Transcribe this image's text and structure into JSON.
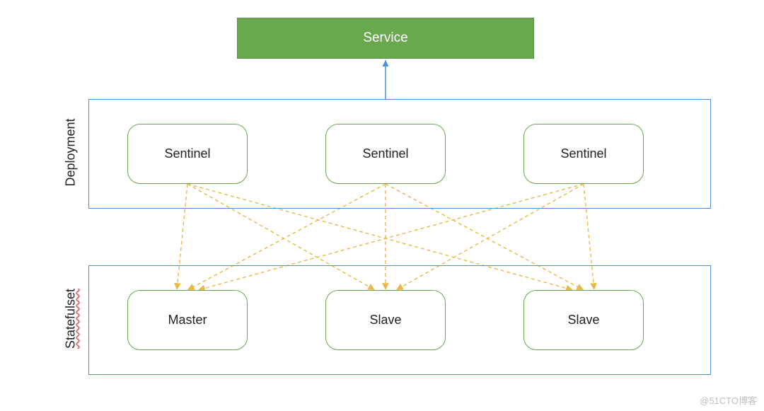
{
  "service": {
    "label": "Service"
  },
  "groups": {
    "deployment": {
      "label": "Deployment"
    },
    "statefulset": {
      "label": "Statefulset"
    }
  },
  "sentinels": [
    {
      "label": "Sentinel"
    },
    {
      "label": "Sentinel"
    },
    {
      "label": "Sentinel"
    }
  ],
  "nodes": [
    {
      "label": "Master"
    },
    {
      "label": "Slave"
    },
    {
      "label": "Slave"
    }
  ],
  "attribution": "@51CTO博客",
  "colors": {
    "service_bg": "#6aa84f",
    "group_border": "#4a90d9",
    "node_border": "#6aa84f",
    "arrow_yellow": "#e8b94a",
    "arrow_blue": "#4a90d9"
  },
  "chart_data": {
    "type": "diagram",
    "title": "",
    "description": "Architecture diagram showing a Service fronting a Deployment of 3 Sentinel instances, each connected to a StatefulSet of 1 Master and 2 Slave nodes.",
    "layers": [
      {
        "name": "Service",
        "kind": "service",
        "nodes": [
          "Service"
        ]
      },
      {
        "name": "Deployment",
        "kind": "deployment",
        "nodes": [
          "Sentinel",
          "Sentinel",
          "Sentinel"
        ]
      },
      {
        "name": "Statefulset",
        "kind": "statefulset",
        "nodes": [
          "Master",
          "Slave",
          "Slave"
        ]
      }
    ],
    "edges": [
      {
        "from": "Deployment",
        "to": "Service",
        "style": "solid-blue-arrow"
      },
      {
        "from": "Sentinel[0]",
        "to": "Master",
        "style": "dashed-yellow-arrow"
      },
      {
        "from": "Sentinel[0]",
        "to": "Slave[0]",
        "style": "dashed-yellow-arrow"
      },
      {
        "from": "Sentinel[0]",
        "to": "Slave[1]",
        "style": "dashed-yellow-arrow"
      },
      {
        "from": "Sentinel[1]",
        "to": "Master",
        "style": "dashed-yellow-arrow"
      },
      {
        "from": "Sentinel[1]",
        "to": "Slave[0]",
        "style": "dashed-yellow-arrow"
      },
      {
        "from": "Sentinel[1]",
        "to": "Slave[1]",
        "style": "dashed-yellow-arrow"
      },
      {
        "from": "Sentinel[2]",
        "to": "Master",
        "style": "dashed-yellow-arrow"
      },
      {
        "from": "Sentinel[2]",
        "to": "Slave[0]",
        "style": "dashed-yellow-arrow"
      },
      {
        "from": "Sentinel[2]",
        "to": "Slave[1]",
        "style": "dashed-yellow-arrow"
      }
    ]
  }
}
